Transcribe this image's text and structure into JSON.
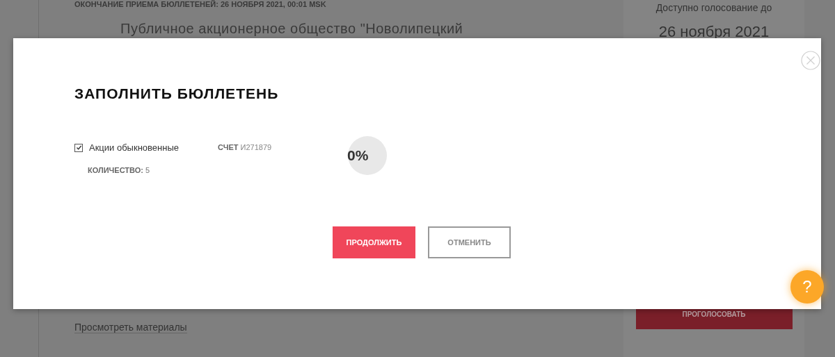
{
  "background": {
    "deadline": "ОКОНЧАНИЕ ПРИЕМА БЮЛЛЕТЕНЕЙ: 26 НОЯБРЯ 2021, 00:01 MSK",
    "issuer": "Публичное акционерное общество \"Новолипецкий",
    "materials_link": "Просмотреть материалы",
    "side_panel": {
      "caption": "Доступно голосование до",
      "date": "26 ноября 2021",
      "vote_button": "ПРОГОЛОСОВАТЬ"
    }
  },
  "modal": {
    "title": "ЗАПОЛНИТЬ БЮЛЛЕТЕНЬ",
    "holdings": [
      {
        "name": "Акции обыкновенные",
        "checked": true,
        "account_label": "СЧЕТ",
        "account": "И271879",
        "quantity_label": "КОЛИЧЕСТВО:",
        "quantity": "5",
        "progress": "0%"
      }
    ],
    "buttons": [
      {
        "label": "ПРОДОЛЖИТЬ",
        "kind": "primary"
      },
      {
        "label": "ОТМЕНИТЬ",
        "kind": "secondary"
      }
    ]
  },
  "help_button": {
    "label": "?"
  }
}
